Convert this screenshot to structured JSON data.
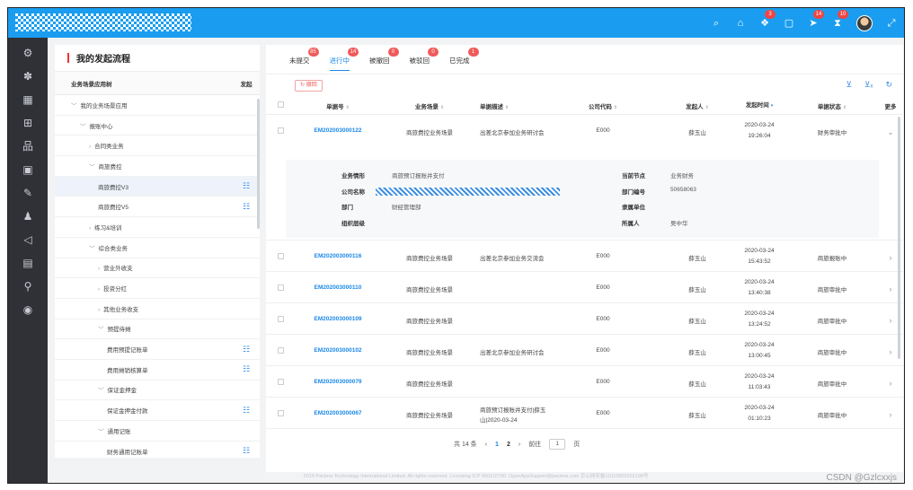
{
  "topbar": {
    "icons": [
      {
        "name": "search-icon",
        "glyph": "⌕",
        "badge": ""
      },
      {
        "name": "home-icon",
        "glyph": "⌂",
        "badge": ""
      },
      {
        "name": "apps-icon",
        "glyph": "❖",
        "badge": "3"
      },
      {
        "name": "window-icon",
        "glyph": "▢",
        "badge": ""
      },
      {
        "name": "send-icon",
        "glyph": "➤",
        "badge": "14"
      },
      {
        "name": "hourglass-icon",
        "glyph": "⧗",
        "badge": "10"
      }
    ],
    "fullscreen_glyph": "⤢"
  },
  "rail": {
    "icons": [
      "settings-icon",
      "grid-icon",
      "table-icon",
      "org-icon",
      "hierarchy-icon",
      "dashboard-icon",
      "edit-icon",
      "user-icon",
      "megaphone-icon",
      "card-icon",
      "search-user-icon",
      "share-icon"
    ],
    "glyphs": [
      "⚙",
      "✽",
      "▦",
      "⊞",
      "品",
      "▣",
      "✎",
      "♟",
      "◁",
      "▤",
      "⚲",
      "◉"
    ]
  },
  "tree": {
    "title": "我的发起流程",
    "col_name": "业务场景应用树",
    "col_action": "发起",
    "nodes": [
      {
        "label": "我的业务场景应用",
        "indent": 0,
        "arrow": "﹀",
        "action": false,
        "selected": false
      },
      {
        "label": "报账中心",
        "indent": 1,
        "arrow": "﹀",
        "action": false,
        "selected": false
      },
      {
        "label": "合同类业务",
        "indent": 2,
        "arrow": "›",
        "action": false,
        "selected": false
      },
      {
        "label": "商旅费控",
        "indent": 2,
        "arrow": "﹀",
        "action": false,
        "selected": false
      },
      {
        "label": "商旅费控V3",
        "indent": 3,
        "arrow": "",
        "action": true,
        "selected": true
      },
      {
        "label": "商旅费控V5",
        "indent": 3,
        "arrow": "",
        "action": true,
        "selected": false
      },
      {
        "label": "练习&培训",
        "indent": 2,
        "arrow": "›",
        "action": false,
        "selected": false
      },
      {
        "label": "综合类业务",
        "indent": 2,
        "arrow": "﹀",
        "action": false,
        "selected": false
      },
      {
        "label": "营业外收支",
        "indent": 3,
        "arrow": "›",
        "action": false,
        "selected": false
      },
      {
        "label": "投资分红",
        "indent": 3,
        "arrow": "›",
        "action": false,
        "selected": false
      },
      {
        "label": "其他业务收支",
        "indent": 3,
        "arrow": "›",
        "action": false,
        "selected": false
      },
      {
        "label": "预提待摊",
        "indent": 3,
        "arrow": "﹀",
        "action": false,
        "selected": false
      },
      {
        "label": "费用预提记账单",
        "indent": 4,
        "arrow": "",
        "action": true,
        "selected": false
      },
      {
        "label": "费用摊销核算单",
        "indent": 4,
        "arrow": "",
        "action": true,
        "selected": false
      },
      {
        "label": "保证金押金",
        "indent": 3,
        "arrow": "﹀",
        "action": false,
        "selected": false
      },
      {
        "label": "保证金押金付款",
        "indent": 4,
        "arrow": "",
        "action": true,
        "selected": false
      },
      {
        "label": "通用记账",
        "indent": 3,
        "arrow": "﹀",
        "action": false,
        "selected": false
      },
      {
        "label": "财务通用记账单",
        "indent": 4,
        "arrow": "",
        "action": true,
        "selected": false
      }
    ]
  },
  "tabs": [
    {
      "label": "未提交",
      "badge": "85",
      "active": false
    },
    {
      "label": "进行中",
      "badge": "14",
      "active": true
    },
    {
      "label": "被撤回",
      "badge": "0",
      "active": false
    },
    {
      "label": "被驳回",
      "badge": "0",
      "active": false
    },
    {
      "label": "已完成",
      "badge": "1",
      "active": false
    }
  ],
  "toolbar": {
    "back_label": "↻ 撤回",
    "tool_glyphs": [
      "⊻",
      "⊻ₓ",
      "↻"
    ]
  },
  "table": {
    "headers": {
      "no": "单据号",
      "scene": "业务场景",
      "desc": "单据描述",
      "code": "公司代码",
      "initiator": "发起人",
      "time": "发起时间",
      "status": "单据状态",
      "more": "更多"
    },
    "rows": [
      {
        "no": "EM202003000122",
        "scene": "商旅费控业务场景",
        "desc": "出差北京参加业务研讨会",
        "code": "E000",
        "initiator": "薛玉山",
        "date": "2020-03-24",
        "time": "19:26:04",
        "status": "财务审批中",
        "expanded": true
      },
      {
        "no": "EM202003000116",
        "scene": "商旅费控业务场景",
        "desc": "出差北京参加业务交流会",
        "code": "E000",
        "initiator": "薛玉山",
        "date": "2020-03-24",
        "time": "15:43:52",
        "status": "商旅报账中",
        "expanded": false
      },
      {
        "no": "EM202003000110",
        "scene": "商旅费控业务场景",
        "desc": "",
        "code": "E000",
        "initiator": "薛玉山",
        "date": "2020-03-24",
        "time": "13:40:38",
        "status": "商旅审批中",
        "expanded": false
      },
      {
        "no": "EM202003000109",
        "scene": "商旅费控业务场景",
        "desc": "",
        "code": "E000",
        "initiator": "薛玉山",
        "date": "2020-03-24",
        "time": "13:24:52",
        "status": "商旅审批中",
        "expanded": false
      },
      {
        "no": "EM202003000102",
        "scene": "商旅费控业务场景",
        "desc": "出差北京参加业务研讨会",
        "code": "E000",
        "initiator": "薛玉山",
        "date": "2020-03-24",
        "time": "13:00:45",
        "status": "商旅审批中",
        "expanded": false
      },
      {
        "no": "EM202003000079",
        "scene": "商旅费控业务场景",
        "desc": "",
        "code": "E000",
        "initiator": "薛玉山",
        "date": "2020-03-24",
        "time": "11:03:43",
        "status": "商旅审批中",
        "expanded": false
      },
      {
        "no": "EM202003000067",
        "scene": "商旅费控业务场景",
        "desc": "商旅预订报账并支付|薛玉山|2020-03-24",
        "code": "E000",
        "initiator": "薛玉山",
        "date": "2020-03-24",
        "time": "01:10:23",
        "status": "商旅审批中",
        "expanded": false
      }
    ],
    "detail": {
      "type_label": "业务情形",
      "type_value": "商旅预订报账并支付",
      "company_label": "公司名称",
      "dept_label": "部门",
      "dept_value": "财经管理部",
      "level_label": "组织层级",
      "node_label": "当前节点",
      "node_value": "业务财务",
      "deptno_label": "部门编号",
      "deptno_value": "50658063",
      "unit_label": "隶属单位",
      "owner_label": "所属人",
      "owner_value": "吴中华"
    }
  },
  "pager": {
    "total": "共 14 条",
    "prev": "‹",
    "pages": [
      "1",
      "2"
    ],
    "current": "1",
    "next": "›",
    "goto": "前往",
    "goto_value": "1",
    "unit": "页"
  },
  "footer": "2019 Pactera Technology International Limited. All rights reserved. Licensing ICP 060110790. OpenAppSupport@pactera.com 京公网安备11010802016198号",
  "watermark": "CSDN @Gzlcxxjs"
}
